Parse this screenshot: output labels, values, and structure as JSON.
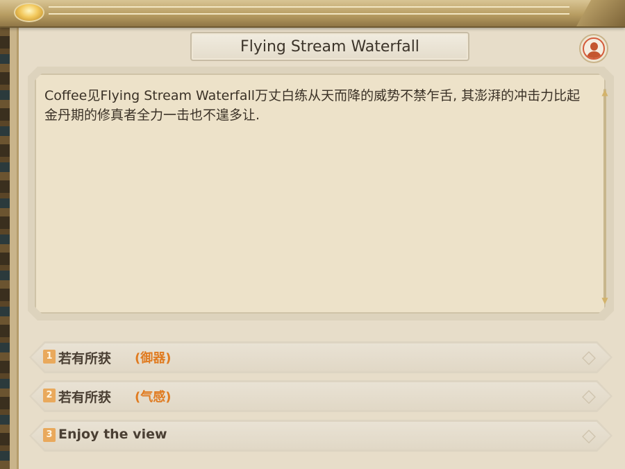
{
  "dialog": {
    "title": "Flying Stream Waterfall",
    "text": "Coffee见Flying Stream Waterfall万丈白练从天而降的威势不禁乍舌, 其澎湃的冲击力比起金丹期的修真者全力一击也不遑多让."
  },
  "options": [
    {
      "number": "1",
      "label": "若有所获",
      "tag": "(御器)"
    },
    {
      "number": "2",
      "label": "若有所获",
      "tag": "(气感)"
    },
    {
      "number": "3",
      "label": "Enjoy the view",
      "tag": ""
    }
  ],
  "icons": {
    "avatar": "character-avatar-icon",
    "scroll_up": "triangle-up-icon",
    "scroll_down": "triangle-down-icon",
    "option_deco": "diamond-ornament-icon"
  },
  "colors": {
    "panel": "#e7ddc9",
    "accent_gold": "#c9b48a",
    "tag_orange": "#e07b20",
    "number_badge": "#e9a95c"
  }
}
